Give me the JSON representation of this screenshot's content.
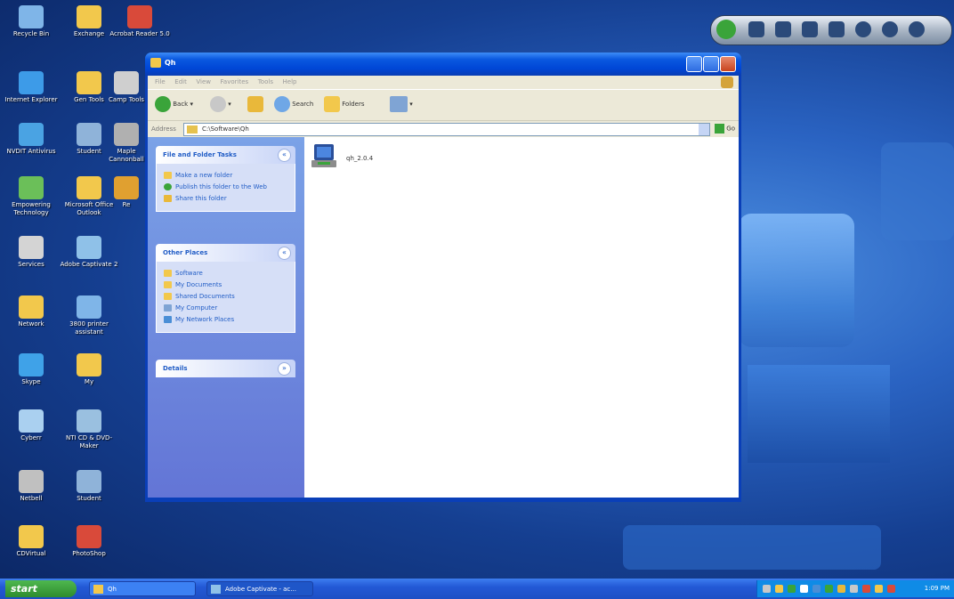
{
  "desktop": {
    "icons": [
      {
        "label": "Recycle Bin",
        "color": "#7fb5e8"
      },
      {
        "label": "Exchange",
        "color": "#f2c84c"
      },
      {
        "label": "Acrobat Reader 5.0",
        "color": "#d94a3a"
      },
      {
        "label": "Internet Explorer",
        "color": "#3d9be8"
      },
      {
        "label": "Gen Tools",
        "color": "#f2c84c"
      },
      {
        "label": "Camp Tools",
        "color": "#cfcfcf"
      },
      {
        "label": "NVDIT Antivirus",
        "color": "#4aa3e3"
      },
      {
        "label": "Student",
        "color": "#8fb3d9"
      },
      {
        "label": "Maple Cannonball",
        "color": "#b0b0b0"
      },
      {
        "label": "Empowering Technology",
        "color": "#6bbf59"
      },
      {
        "label": "Microsoft Office Outlook",
        "color": "#f2c84c"
      },
      {
        "label": "Re",
        "color": "#e0a030"
      },
      {
        "label": "Services",
        "color": "#d4d4d4"
      },
      {
        "label": "Adobe Captivate 2",
        "color": "#8fc1e8"
      },
      {
        "label": "Network",
        "color": "#f2c84c"
      },
      {
        "label": "3800 printer assistant",
        "color": "#7fb5e8"
      },
      {
        "label": "Skype",
        "color": "#3fa2e8"
      },
      {
        "label": "My",
        "color": "#f2c84c"
      },
      {
        "label": "Cyberr",
        "color": "#aad0f0"
      },
      {
        "label": "NTI CD & DVD-Maker",
        "color": "#9ac0e0"
      },
      {
        "label": "Netbell",
        "color": "#c0c0c0"
      },
      {
        "label": "Student",
        "color": "#8fb3d9"
      },
      {
        "label": "CDVirtual",
        "color": "#f2c84c"
      },
      {
        "label": "PhotoShop",
        "color": "#d94a3a"
      }
    ]
  },
  "window": {
    "title": "Qh",
    "menu": [
      "File",
      "Edit",
      "View",
      "Favorites",
      "Tools",
      "Help"
    ],
    "toolbar": {
      "back": "Back",
      "search": "Search",
      "folders": "Folders"
    },
    "address": {
      "label": "Address",
      "value": "C:\\Software\\Qh",
      "go": "Go"
    },
    "tasks_panel": {
      "title": "File and Folder Tasks",
      "items": [
        "Make a new folder",
        "Publish this folder to the Web",
        "Share this folder"
      ]
    },
    "places_panel": {
      "title": "Other Places",
      "items": [
        "Software",
        "My Documents",
        "Shared Documents",
        "My Computer",
        "My Network Places"
      ]
    },
    "details_panel": {
      "title": "Details"
    },
    "files": [
      {
        "name": "qh_2.0.4"
      }
    ]
  },
  "taskbar": {
    "start": "start",
    "tasks": [
      "Qh",
      "Adobe Captivate - ac..."
    ],
    "clock": "1:09 PM"
  },
  "colors": {
    "xp_blue": "#0a58e0",
    "taskpane": "#d6dff7",
    "start_green": "#3aa43a"
  }
}
